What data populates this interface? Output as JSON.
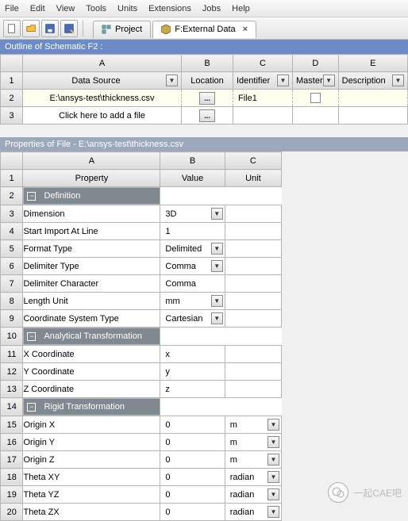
{
  "menu": {
    "items": [
      "File",
      "Edit",
      "View",
      "Tools",
      "Units",
      "Extensions",
      "Jobs",
      "Help"
    ]
  },
  "tabs": {
    "project": "Project",
    "active": "F:External Data"
  },
  "outline": {
    "title": "Outline of Schematic F2 :",
    "cols": {
      "A": "A",
      "B": "B",
      "C": "C",
      "D": "D",
      "E": "E"
    },
    "headers": {
      "ds": "Data Source",
      "loc": "Location",
      "id": "Identifier",
      "master": "Master",
      "desc": "Description"
    },
    "rows": {
      "r1": "1",
      "r2": "2",
      "r3": "3",
      "file_path": "E:\\ansys-test\\thickness.csv",
      "file_id": "File1",
      "add_hint": "Click here to add a file",
      "browse": "..."
    }
  },
  "props": {
    "title": "Properties of File - E:\\ansys-test\\thickness.csv",
    "cols": {
      "A": "A",
      "B": "B",
      "C": "C"
    },
    "hdr": {
      "prop": "Property",
      "val": "Value",
      "unit": "Unit"
    },
    "sections": {
      "def": "Definition",
      "ana": "Analytical Transformation",
      "rig": "Rigid Transformation"
    },
    "rows": {
      "r1": "1",
      "r2": "2",
      "r3": "3",
      "r4": "4",
      "r5": "5",
      "r6": "6",
      "r7": "7",
      "r8": "8",
      "r9": "9",
      "r10": "10",
      "r11": "11",
      "r12": "12",
      "r13": "13",
      "r14": "14",
      "r15": "15",
      "r16": "16",
      "r17": "17",
      "r18": "18",
      "r19": "19",
      "r20": "20"
    },
    "p": {
      "dim": "Dimension",
      "dim_v": "3D",
      "start": "Start Import At Line",
      "start_v": "1",
      "fmt": "Format Type",
      "fmt_v": "Delimited",
      "delim": "Delimiter Type",
      "delim_v": "Comma",
      "dchar": "Delimiter Character",
      "dchar_v": "Comma",
      "len": "Length Unit",
      "len_v": "mm",
      "cst": "Coordinate System Type",
      "cst_v": "Cartesian",
      "xc": "X Coordinate",
      "xc_v": "x",
      "yc": "Y Coordinate",
      "yc_v": "y",
      "zc": "Z Coordinate",
      "zc_v": "z",
      "ox": "Origin X",
      "ox_v": "0",
      "ox_u": "m",
      "oy": "Origin Y",
      "oy_v": "0",
      "oy_u": "m",
      "oz": "Origin Z",
      "oz_v": "0",
      "oz_u": "m",
      "txy": "Theta XY",
      "txy_v": "0",
      "txy_u": "radian",
      "tyz": "Theta YZ",
      "tyz_v": "0",
      "tyz_u": "radian",
      "tzx": "Theta ZX",
      "tzx_v": "0",
      "tzx_u": "radian"
    }
  },
  "watermark": "一起CAE吧"
}
